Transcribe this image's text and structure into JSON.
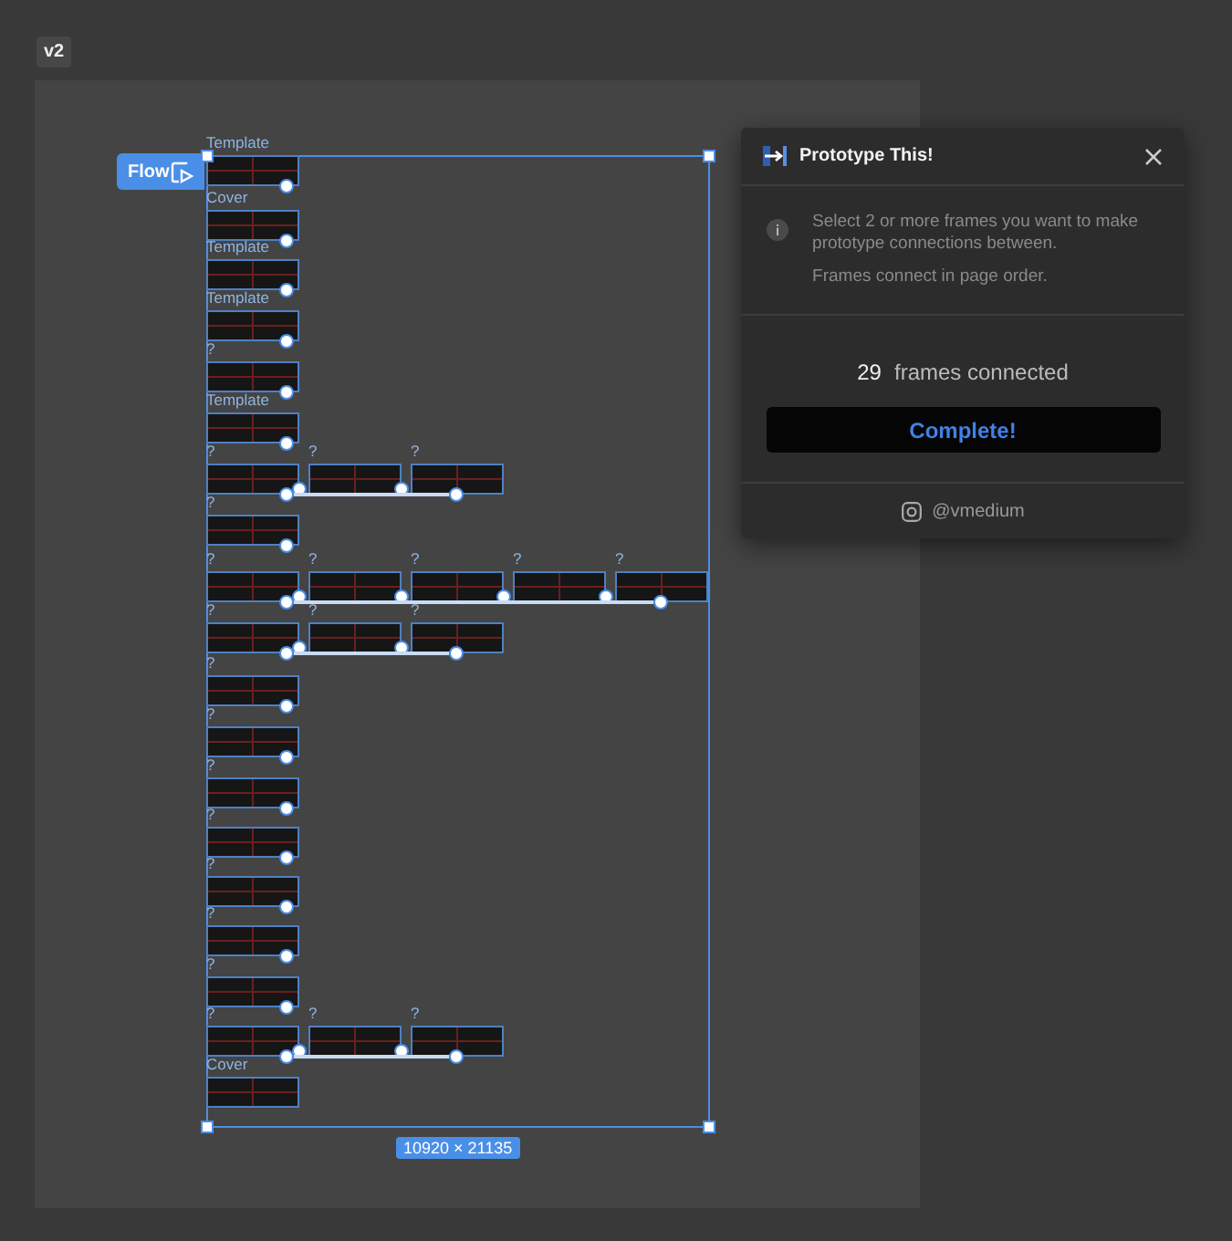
{
  "page_tab": {
    "label": "v2"
  },
  "canvas": {
    "flow_button": "Flow",
    "size_badge": "10920 × 21135",
    "rows": [
      {
        "frames": [
          {
            "label": "Template"
          }
        ]
      },
      {
        "frames": [
          {
            "label": "Cover"
          }
        ]
      },
      {
        "frames": [
          {
            "label": "Template"
          }
        ]
      },
      {
        "frames": [
          {
            "label": "Template"
          }
        ]
      },
      {
        "frames": [
          {
            "label": "?"
          }
        ]
      },
      {
        "frames": [
          {
            "label": "Template"
          }
        ]
      },
      {
        "frames": [
          {
            "label": "?"
          },
          {
            "label": "?"
          },
          {
            "label": "?"
          }
        ]
      },
      {
        "frames": [
          {
            "label": "?"
          }
        ]
      },
      {
        "frames": [
          {
            "label": "?"
          },
          {
            "label": "?"
          },
          {
            "label": "?"
          },
          {
            "label": "?"
          },
          {
            "label": "?"
          }
        ]
      },
      {
        "frames": [
          {
            "label": "?"
          },
          {
            "label": "?"
          },
          {
            "label": "?"
          }
        ]
      },
      {
        "frames": [
          {
            "label": "?"
          }
        ]
      },
      {
        "frames": [
          {
            "label": "?"
          }
        ]
      },
      {
        "frames": [
          {
            "label": "?"
          }
        ]
      },
      {
        "frames": [
          {
            "label": "?"
          }
        ]
      },
      {
        "frames": [
          {
            "label": "?"
          }
        ]
      },
      {
        "frames": [
          {
            "label": "?"
          }
        ]
      },
      {
        "frames": [
          {
            "label": "?"
          }
        ]
      },
      {
        "frames": [
          {
            "label": "?"
          },
          {
            "label": "?"
          },
          {
            "label": "?"
          }
        ]
      },
      {
        "frames": [
          {
            "label": "Cover"
          }
        ]
      }
    ]
  },
  "panel": {
    "title": "Prototype This!",
    "info": "Select 2 or more frames you want to make prototype connections between.",
    "note": "Frames connect in page order.",
    "count": "29",
    "count_label": "frames connected",
    "button": "Complete!",
    "handle": "@vmedium"
  }
}
